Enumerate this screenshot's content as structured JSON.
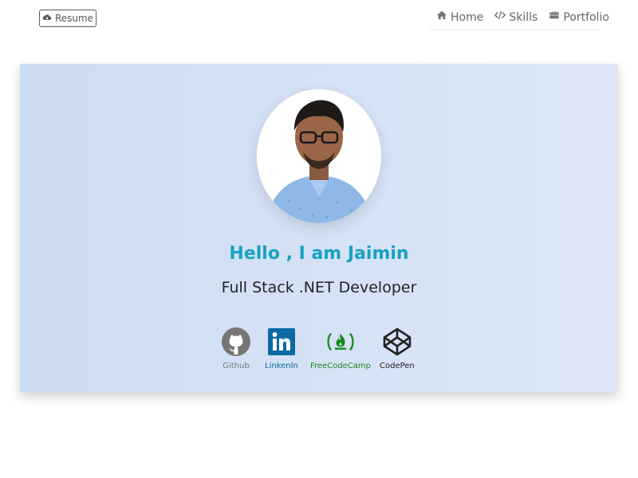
{
  "header": {
    "resume_label": "Resume",
    "nav": [
      {
        "label": "Home",
        "icon": "home-icon"
      },
      {
        "label": "Skills",
        "icon": "code-icon"
      },
      {
        "label": "Portfolio",
        "icon": "briefcase-icon"
      }
    ]
  },
  "hero": {
    "greeting": "Hello , I am Jaimin",
    "role": "Full Stack .NET Developer",
    "socials": [
      {
        "label": "Github",
        "icon": "github-icon",
        "color": "#777777"
      },
      {
        "label": "LinkenIn",
        "icon": "linkedin-icon",
        "color": "#0e6ea3"
      },
      {
        "label": "FreeCodeCamp",
        "icon": "freecodecamp-icon",
        "color": "#168b1f"
      },
      {
        "label": "CodePen",
        "icon": "codepen-icon",
        "color": "#222222"
      }
    ]
  },
  "colors": {
    "accent": "#17a2c2",
    "hero_bg_start": "#cddcf3",
    "hero_bg_end": "#dde7f8"
  }
}
